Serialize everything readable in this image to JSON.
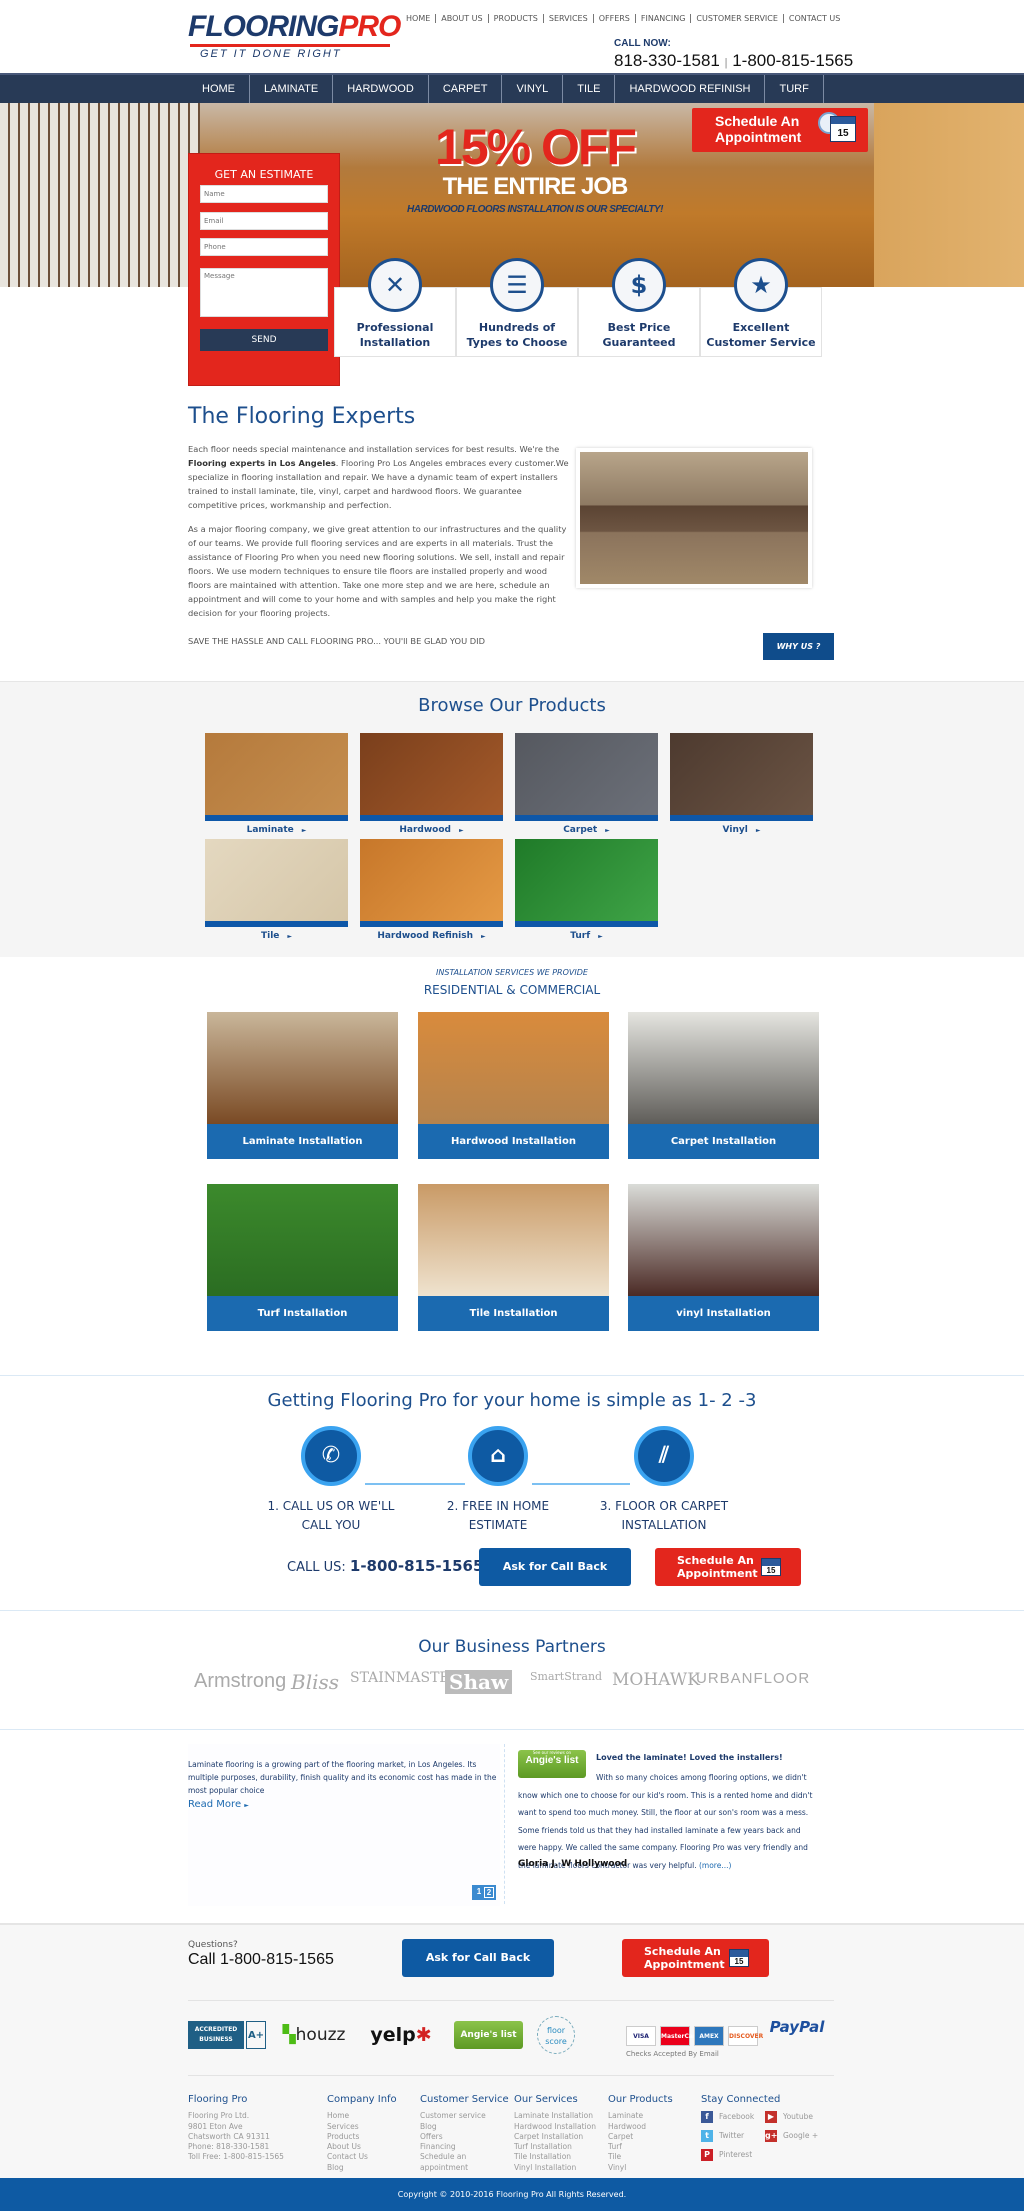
{
  "header": {
    "logo_main": "FLOORING",
    "logo_accent": "PRO",
    "tagline": "GET IT DONE RIGHT",
    "top_links": [
      "HOME",
      "ABOUT US",
      "PRODUCTS",
      "SERVICES",
      "OFFERS",
      "FINANCING",
      "CUSTOMER SERVICE",
      "CONTACT US"
    ],
    "call_now": "CALL NOW:",
    "phone1": "818-330-1581",
    "phone_sep": "|",
    "phone2": "1-800-815-1565"
  },
  "nav": [
    "HOME",
    "LAMINATE",
    "HARDWOOD",
    "CARPET",
    "VINYL",
    "TILE",
    "HARDWOOD REFINISH",
    "TURF"
  ],
  "hero": {
    "headline": "15% OFF",
    "subheadline": "THE ENTIRE JOB",
    "tagline": "HARDWOOD FLOORS INSTALLATION IS OUR SPECIALTY!",
    "schedule_line1": "Schedule An",
    "schedule_line2": "Appointment",
    "calendar_day": "15"
  },
  "estimate": {
    "title": "GET AN ESTIMATE",
    "name_placeholder": "Name",
    "email_placeholder": "Email",
    "phone_placeholder": "Phone",
    "message_placeholder": "Message",
    "send": "SEND"
  },
  "features": [
    {
      "icon": "tools-icon",
      "glyph": "✕",
      "line1": "Professional",
      "line2": "Installation"
    },
    {
      "icon": "clipboard-icon",
      "glyph": "☰",
      "line1": "Hundreds of",
      "line2": "Types to Choose"
    },
    {
      "icon": "price-tag-icon",
      "glyph": "$",
      "line1": "Best Price",
      "line2": "Guaranteed"
    },
    {
      "icon": "customer-rating-icon",
      "glyph": "★",
      "line1": "Excellent",
      "line2": "Customer Service"
    }
  ],
  "experts": {
    "title": "The Flooring Experts",
    "p1_a": "Each floor needs special maintenance and installation services for best results. We're the ",
    "p1_bold": "Flooring experts in Los Angeles",
    "p1_b": ".  Flooring Pro Los Angeles embraces every customer.We specialize in flooring installation and repair. We have a dynamic team of expert installers trained to install laminate, tile, vinyl, carpet and hardwood floors. We guarantee competitive prices, workmanship  and perfection.",
    "p2": "As a major flooring company, we give great attention to our infrastructures and the quality of our teams. We provide full flooring services and are experts in all materials. Trust the assistance of Flooring Pro when you need new flooring solutions. We sell, install and repair floors. We use modern techniques to ensure tile floors are installed properly and wood floors are maintained with attention. Take one more step and we are here,  schedule an appointment and will come to your home and with samples and help you make the right decision for your flooring projects.",
    "cta": "SAVE THE HASSLE AND CALL FLOORING PRO... YOU'll BE GLAD YOU DID",
    "why_us": "WHY US ?"
  },
  "products": {
    "title": "Browse Our Products",
    "items": [
      {
        "label": "Laminate",
        "arrow": "►",
        "colors": [
          "#b57a3c",
          "#c58e4f"
        ]
      },
      {
        "label": "Hardwood",
        "arrow": "►",
        "colors": [
          "#7a3f1c",
          "#a45a2a"
        ]
      },
      {
        "label": "Carpet",
        "arrow": "►",
        "colors": [
          "#55585f",
          "#6c7079"
        ]
      },
      {
        "label": "Vinyl",
        "arrow": "►",
        "colors": [
          "#4d3a2f",
          "#6b5444"
        ]
      },
      {
        "label": "Tile",
        "arrow": "►",
        "colors": [
          "#e4d8c0",
          "#d5c6a8"
        ]
      },
      {
        "label": "Hardwood Refinish",
        "arrow": "►",
        "colors": [
          "#c7772a",
          "#e59a45"
        ]
      },
      {
        "label": "Turf",
        "arrow": "►",
        "colors": [
          "#1f7a28",
          "#3fa447"
        ]
      }
    ]
  },
  "installation": {
    "subtitle": "INSTALLATION SERVICES WE PROVIDE",
    "title": "RESIDENTIAL & COMMERCIAL",
    "items": [
      {
        "label": "Laminate Installation",
        "colors": [
          "#c9b69a",
          "#7a4a24"
        ]
      },
      {
        "label": "Hardwood Installation",
        "colors": [
          "#d98b3c",
          "#b5834d"
        ]
      },
      {
        "label": "Carpet Installation",
        "colors": [
          "#e5e5e0",
          "#5f5d59"
        ]
      },
      {
        "label": "Turf Installation",
        "colors": [
          "#3c8a2c",
          "#2b6d22"
        ]
      },
      {
        "label": "Tile Installation",
        "colors": [
          "#c99a66",
          "#efe3cf"
        ]
      },
      {
        "label": "vinyl Installation",
        "colors": [
          "#dadcd8",
          "#4b2a25"
        ]
      }
    ]
  },
  "steps": {
    "title": "Getting Flooring Pro for your home is simple as 1- 2 -3",
    "items": [
      {
        "icon": "phone-icon",
        "glyph": "✆",
        "line1": "1. CALL US OR WE'LL",
        "line2": "CALL YOU"
      },
      {
        "icon": "home-icon",
        "glyph": "⌂",
        "line1": "2. FREE IN HOME",
        "line2": "ESTIMATE"
      },
      {
        "icon": "floor-planks-icon",
        "glyph": "⫽",
        "line1": "3. FLOOR OR CARPET",
        "line2": "INSTALLATION"
      }
    ],
    "call_label": "CALL US:",
    "call_number": "1-800-815-1565",
    "callback": "Ask for Call Back",
    "schedule_line1": "Schedule An",
    "schedule_line2": "Appointment",
    "calendar_day": "15"
  },
  "partners": {
    "title": "Our Business Partners",
    "logos": [
      "Armstrong",
      "Bliss",
      "STAINMASTER",
      "Shaw",
      "SmartStrand",
      "MOHAWK",
      "URBANFLOOR"
    ]
  },
  "testimonials": {
    "left_text": "Laminate flooring is a growing part of the flooring market, in Los Angeles. Its multiple purposes, durability, finish quality and its economic cost has made in the most popular choice",
    "read_more": "Read More",
    "read_more_arrow": "►",
    "pages": [
      "1",
      "2"
    ],
    "badge_small": "See our reviews on",
    "badge": "Angie's list",
    "heading": "Loved the laminate! Loved the installers!",
    "body": "With so many choices among flooring options, we didn't know which one to choose for our kid's room. This is a rented home and didn't want to spend too much money. Still, the floor at our son's room was a mess. Some friends told us that they had installed laminate a few years back and were happy. We called the same company. Flooring Pro was very friendly and the laminate floors contractor was very helpful. ",
    "more": "(more...)",
    "author": "Gloria J. W Hollywood"
  },
  "cta_bar": {
    "questions": "Questions?",
    "call": "Call 1-800-815-1565",
    "callback": "Ask for Call Back",
    "schedule_line1": "Schedule An",
    "schedule_line2": "Appointment",
    "calendar_day": "15"
  },
  "badges": {
    "bbb": "ACCREDITED BUSINESS",
    "bbb_grade": "A+",
    "houzz": "houzz",
    "yelp": "yelp",
    "angies": "Angie's list",
    "floorscore": "floor score",
    "cards": [
      "VISA",
      "MasterCard",
      "AMEX",
      "DISCOVER"
    ],
    "paypal": "PayPal",
    "checks": "Checks Accepted By Email"
  },
  "footer": {
    "columns": [
      {
        "title": "Flooring Pro",
        "links": [
          "Flooring Pro Ltd.",
          "9801 Eton Ave",
          "Chatsworth CA 91311",
          "Phone: 818-330-1581",
          "Toll Free: 1-800-815-1565"
        ]
      },
      {
        "title": "Company Info",
        "links": [
          "Home",
          "Services",
          "Products",
          "About Us",
          "Contact Us",
          "Blog"
        ]
      },
      {
        "title": "Customer Service",
        "links": [
          "Customer service",
          "Blog",
          "Offers",
          "Financing",
          "Schedule an",
          "appointment"
        ]
      },
      {
        "title": "Our Services",
        "links": [
          "Laminate Installation",
          "Hardwood Installation",
          "Carpet Installation",
          "Turf Installation",
          "Tile Installation",
          "Vinyl Installation"
        ]
      },
      {
        "title": "Our Products",
        "links": [
          "Laminate",
          "Hardwood",
          "Carpet",
          "Turf",
          "Tile",
          "Vinyl"
        ]
      }
    ],
    "social_title": "Stay Connected",
    "social": [
      {
        "label": "Facebook",
        "glyph": "f",
        "color": "#3b5998",
        "icon": "facebook-icon"
      },
      {
        "label": "Youtube",
        "glyph": "▶",
        "color": "#c4302b",
        "icon": "youtube-icon"
      },
      {
        "label": "Twitter",
        "glyph": "t",
        "color": "#4fb3e8",
        "icon": "twitter-icon"
      },
      {
        "label": "Google +",
        "glyph": "g+",
        "color": "#c4302b",
        "icon": "google-plus-icon"
      },
      {
        "label": "Pinterest",
        "glyph": "P",
        "color": "#cb2027",
        "icon": "pinterest-icon"
      }
    ],
    "copyright": "Copyright © 2010-2016 Flooring Pro All Rights Reserved."
  },
  "colors": {
    "navy": "#283a56",
    "brand_blue": "#0e5aa3",
    "brand_red": "#e3261d"
  }
}
